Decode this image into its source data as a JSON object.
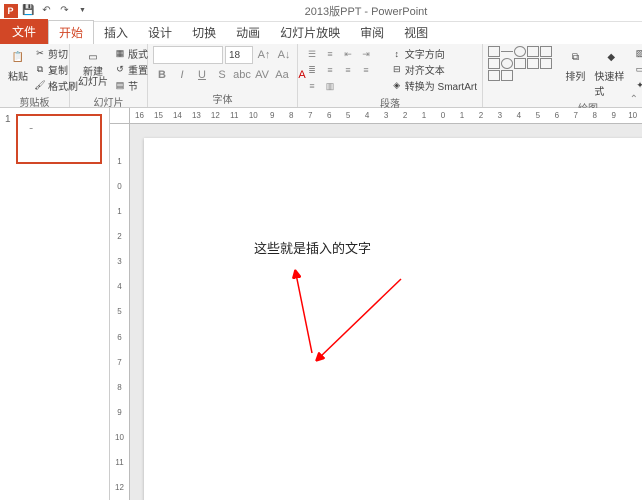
{
  "titlebar": {
    "title": "2013版PPT - PowerPoint"
  },
  "tabs": {
    "file": "文件",
    "items": [
      "开始",
      "插入",
      "设计",
      "切换",
      "动画",
      "幻灯片放映",
      "审阅",
      "视图"
    ],
    "active": 0
  },
  "ribbon": {
    "clipboard": {
      "label": "剪贴板",
      "paste": "粘贴",
      "cut": "剪切",
      "copy": "复制",
      "painter": "格式刷"
    },
    "slides": {
      "label": "幻灯片",
      "new": "新建\n幻灯片",
      "layout": "版式",
      "reset": "重置",
      "section": "节"
    },
    "font": {
      "label": "字体",
      "size": "18"
    },
    "paragraph": {
      "label": "段落",
      "direction": "文字方向",
      "align": "对齐文本",
      "smartart": "转换为 SmartArt"
    },
    "drawing": {
      "label": "绘图",
      "arrange": "排列",
      "quickstyle": "快速样式",
      "fill": "形状填充",
      "outline": "形状轮廓",
      "effects": "形状效果"
    }
  },
  "ruler_h": [
    "16",
    "15",
    "14",
    "13",
    "12",
    "11",
    "10",
    "9",
    "8",
    "7",
    "6",
    "5",
    "4",
    "3",
    "2",
    "1",
    "0",
    "1",
    "2",
    "3",
    "4",
    "5",
    "6",
    "7",
    "8",
    "9",
    "10"
  ],
  "ruler_v": [
    "",
    "1",
    "0",
    "1",
    "2",
    "3",
    "4",
    "5",
    "6",
    "7",
    "8",
    "9",
    "10",
    "11",
    "12"
  ],
  "slide": {
    "number": "1",
    "text": "这些就是插入的文字"
  }
}
